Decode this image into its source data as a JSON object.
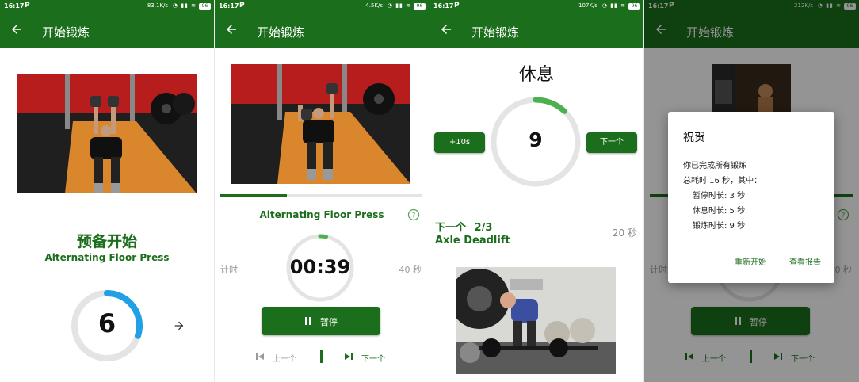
{
  "screens": [
    {
      "status": {
        "time": "16:17",
        "speed": "83.1K/s"
      },
      "title": "开始锻炼",
      "heading": "预备开始",
      "exercise": "Alternating Floor Press",
      "countdown": "6",
      "countdown_fraction": 0.3
    },
    {
      "status": {
        "time": "16:17",
        "speed": "4.5K/s"
      },
      "title": "开始锻炼",
      "exercise": "Alternating Floor Press",
      "timer_label": "计时",
      "timer": "00:39",
      "duration": "40 秒",
      "progress_fraction": 0.33,
      "ring_fraction": 0.03,
      "pause_label": "暂停",
      "prev_label": "上一个",
      "next_label": "下一个"
    },
    {
      "status": {
        "time": "16:17",
        "speed": "107K/s"
      },
      "title": "开始锻炼",
      "heading": "休息",
      "add_time_label": "+10s",
      "countdown": "9",
      "ring_fraction": 0.12,
      "skip_label": "下一个",
      "next_prefix": "下一个",
      "next_index": "2/3",
      "next_exercise": "Axle Deadlift",
      "next_duration": "20 秒"
    },
    {
      "status": {
        "time": "16:17",
        "speed": "212K/s"
      },
      "title": "开始锻炼",
      "timer_label": "计时",
      "duration": "40 秒",
      "pause_label": "暂停",
      "prev_label": "上一个",
      "next_label": "下一个",
      "dialog": {
        "title": "祝贺",
        "line1": "你已完成所有锻炼",
        "line2": "总耗时 16 秒，其中：",
        "line3": "暂停时长: 3 秒",
        "line4": "休息时长: 5 秒",
        "line5": "锻炼时长: 9 秒",
        "restart_label": "重新开始",
        "report_label": "查看报告"
      }
    }
  ],
  "colors": {
    "primary": "#1b6e1b",
    "ring_blue": "#22a0e6",
    "ring_green": "#4caf50",
    "ring_track": "#e4e4e4"
  }
}
